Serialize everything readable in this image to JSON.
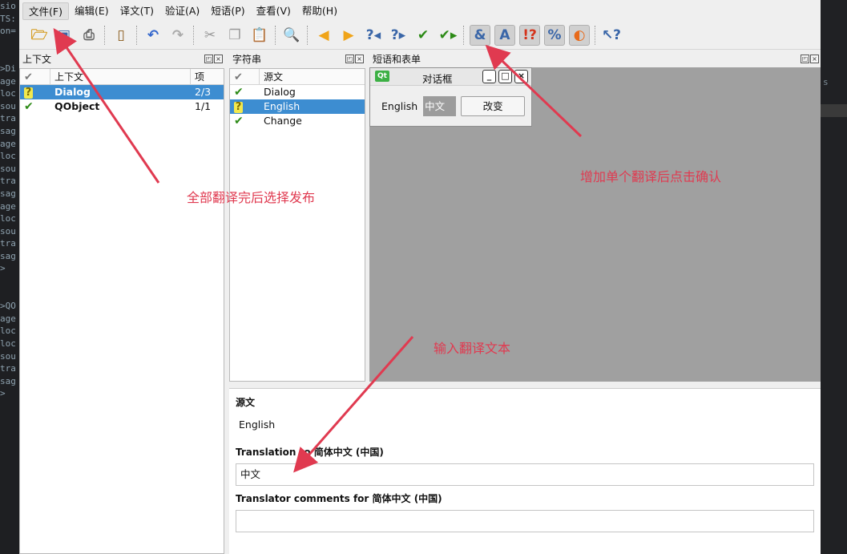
{
  "terminal": {
    "lines": [
      "sio",
      "TS:",
      "on=",
      "",
      "",
      ">Di",
      "age",
      "loc",
      "sou",
      "tra",
      "sag",
      "age",
      "loc",
      "sou",
      "tra",
      "sag",
      "age",
      "loc",
      "sou",
      "tra",
      "sag",
      ">",
      "",
      "",
      ">QO",
      "age",
      "loc",
      "loc",
      "sou",
      "tra",
      "sag",
      ">"
    ],
    "right_glyph": "s"
  },
  "menubar": {
    "items": [
      "文件(F)",
      "编辑(E)",
      "译文(T)",
      "验证(A)",
      "短语(P)",
      "查看(V)",
      "帮助(H)"
    ]
  },
  "toolbar": {
    "icons": [
      "open-icon",
      "save-icon",
      "print-icon",
      "phrasebook-icon",
      "undo-icon",
      "redo-icon",
      "cut-icon",
      "copy-icon",
      "paste-icon",
      "find-icon",
      "prev-icon",
      "next-icon",
      "prev-unfinished-icon",
      "next-unfinished-icon",
      "done-icon",
      "done-and-next-icon",
      "accelerator-check-icon",
      "punctuation-check-icon",
      "phrase-check-icon",
      "placemarker-check-icon",
      "surrounding-whitespace-check-icon",
      "whats-this-icon"
    ]
  },
  "context_pane": {
    "title": "上下文",
    "columns": [
      "",
      "上下文",
      "项"
    ],
    "rows": [
      {
        "status": "question",
        "name": "Dialog",
        "items": "2/3",
        "selected": true
      },
      {
        "status": "done",
        "name": "QObject",
        "items": "1/1",
        "selected": false
      }
    ]
  },
  "strings_pane": {
    "title": "字符串",
    "columns": [
      "",
      "源文"
    ],
    "rows": [
      {
        "status": "done",
        "text": "Dialog",
        "selected": false
      },
      {
        "status": "question",
        "text": "English",
        "selected": true
      },
      {
        "status": "done",
        "text": "Change",
        "selected": false
      }
    ]
  },
  "phrases_pane": {
    "title": "短语和表单"
  },
  "preview_dialog": {
    "logo": "Qt",
    "title": "对话框",
    "label": "English",
    "field_value": "中文",
    "button": "改变"
  },
  "editor": {
    "source_label": "源文",
    "source_text": "English",
    "translation_label": "Translation to 简体中文 (中国)",
    "translation_value": "中文",
    "comments_label": "Translator comments for 简体中文 (中国)",
    "comments_value": ""
  },
  "annotations": {
    "publish": "全部翻译完后选择发布",
    "confirm": "增加单个翻译后点击确认",
    "input": "输入翻译文本"
  },
  "colors": {
    "annotation": "#e03a50",
    "selection": "#3d8dd1"
  }
}
